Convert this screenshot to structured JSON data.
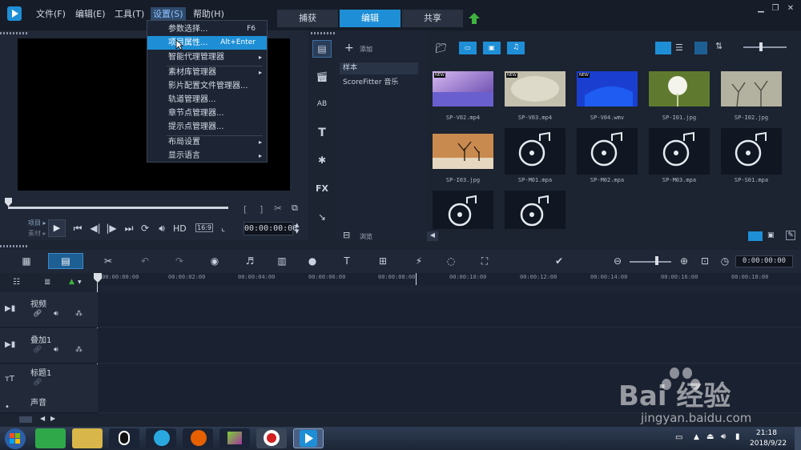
{
  "menu": {
    "file": "文件(F)",
    "edit": "编辑(E)",
    "tools": "工具(T)",
    "settings": "设置(S)",
    "help": "帮助(H)"
  },
  "mode_tabs": [
    "捕获",
    "编辑",
    "共享"
  ],
  "settings_menu": {
    "items": [
      {
        "label": "参数选择...",
        "shortcut": "F6"
      },
      {
        "label": "项目属性...",
        "shortcut": "Alt+Enter"
      },
      {
        "label": "智能代理管理器",
        "arrow": "▸"
      },
      {
        "label": "素材库管理器",
        "arrow": "▸"
      },
      {
        "label": "影片配置文件管理器..."
      },
      {
        "label": "轨道管理器..."
      },
      {
        "label": "章节点管理器..."
      },
      {
        "label": "提示点管理器..."
      },
      {
        "label": "布局设置",
        "arrow": "▸"
      },
      {
        "label": "显示语言",
        "arrow": "▸"
      }
    ]
  },
  "preview": {
    "project_label": "项目 ▸",
    "clip_label": "素材 ▸",
    "hd_label": "HD",
    "ratio_label": "16:9",
    "timecode": "00:00:00:00"
  },
  "library": {
    "add_label": "添加",
    "browse_label": "浏览",
    "folders": [
      "样本",
      "ScoreFitter 音乐"
    ],
    "items": [
      {
        "name": "SP-V02.mp4",
        "new": "NEW"
      },
      {
        "name": "SP-V03.mp4",
        "new": "NEW"
      },
      {
        "name": "SP-V04.wmv",
        "new": "NEW"
      },
      {
        "name": "SP-I01.jpg"
      },
      {
        "name": "SP-I02.jpg"
      },
      {
        "name": "SP-I03.jpg"
      },
      {
        "name": "SP-M01.mpa"
      },
      {
        "name": "SP-M02.mpa"
      },
      {
        "name": "SP-M03.mpa"
      },
      {
        "name": "SP-S01.mpa"
      },
      {
        "name": ""
      },
      {
        "name": ""
      }
    ]
  },
  "timeline": {
    "timecode": "0:00:00:00",
    "ruler": [
      "00:00:00:00",
      "00:00:02:00",
      "00:00:04:00",
      "00:00:06:00",
      "00:00:08:00",
      "00:00:10:00",
      "00:00:12:00",
      "00:00:14:00",
      "00:00:16:00",
      "00:00:18:00"
    ],
    "tracks": [
      "视频",
      "叠加1",
      "标题1",
      "声音"
    ]
  },
  "taskbar": {
    "time": "21:18",
    "date": "2018/9/22"
  },
  "watermark": {
    "brand": "Bai 经验",
    "url": "jingyan.baidu.com"
  },
  "colors": {
    "accent": "#1e8fd6",
    "background": "#1c2331"
  }
}
